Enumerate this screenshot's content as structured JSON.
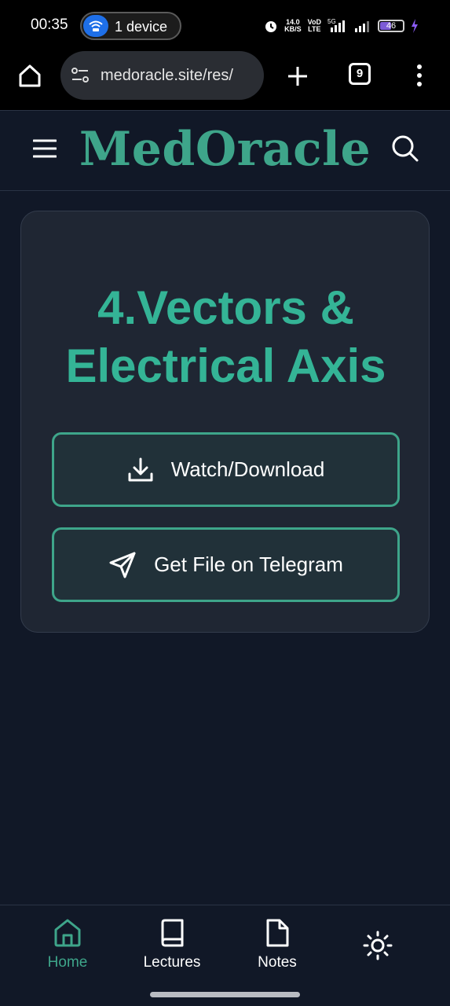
{
  "status_bar": {
    "time": "00:35",
    "device_pill": "1 device",
    "net_speed_top": "14.0",
    "net_speed_bottom": "KB/S",
    "volte_top": "VoD",
    "volte_bottom": "LTE",
    "signal_label": "5G",
    "battery": "46"
  },
  "browser": {
    "url": "medoracle.site/res/",
    "tab_count": "9"
  },
  "header": {
    "brand": "MedOracle"
  },
  "card": {
    "title_line1": "4.Vectors &",
    "title_line2": "Electrical Axis",
    "watch_label": "Watch/Download",
    "telegram_label": "Get File on Telegram"
  },
  "bottom_nav": {
    "items": [
      {
        "label": "Home",
        "icon": "home-icon",
        "active": true
      },
      {
        "label": "Lectures",
        "icon": "book-icon",
        "active": false
      },
      {
        "label": "Notes",
        "icon": "file-icon",
        "active": false
      },
      {
        "label": "",
        "icon": "sun-icon",
        "active": false
      }
    ]
  },
  "colors": {
    "accent": "#3ea58a",
    "title": "#34b496",
    "background": "#111827",
    "card": "#1f2633"
  }
}
